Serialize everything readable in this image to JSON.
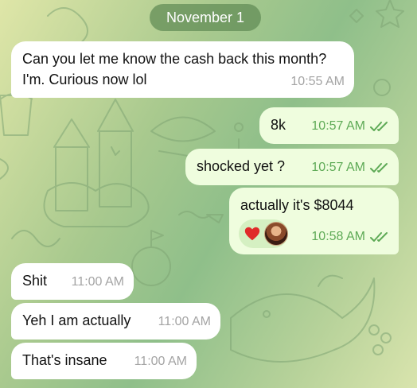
{
  "date_header": "November 1",
  "messages": [
    {
      "type": "incoming",
      "text_line1": "Can you let me know the cash back this month?",
      "text_line2": "I'm. Curious now lol",
      "time": "10:55 AM"
    },
    {
      "type": "outgoing",
      "text": "8k",
      "time": "10:57 AM",
      "status": "read"
    },
    {
      "type": "outgoing",
      "text": "shocked yet ?",
      "time": "10:57 AM",
      "status": "read"
    },
    {
      "type": "outgoing",
      "text": "actually it's $8044",
      "time": "10:58 AM",
      "status": "read",
      "reactions": [
        "heart",
        "user-avatar"
      ]
    },
    {
      "type": "incoming",
      "text": "Shit",
      "time": "11:00 AM"
    },
    {
      "type": "incoming",
      "text": "Yeh I am actually",
      "time": "11:00 AM"
    },
    {
      "type": "incoming",
      "text": "That's insane",
      "time": "11:00 AM"
    }
  ],
  "colors": {
    "outgoing_bubble": "#effdde",
    "incoming_bubble": "#ffffff",
    "read_check": "#5eaa56",
    "date_pill": "#608a54",
    "heart": "#e02a2a"
  },
  "icons": {
    "read_status": "double-check-icon",
    "reaction_heart": "heart-icon",
    "reaction_avatar": "reactor-avatar"
  }
}
